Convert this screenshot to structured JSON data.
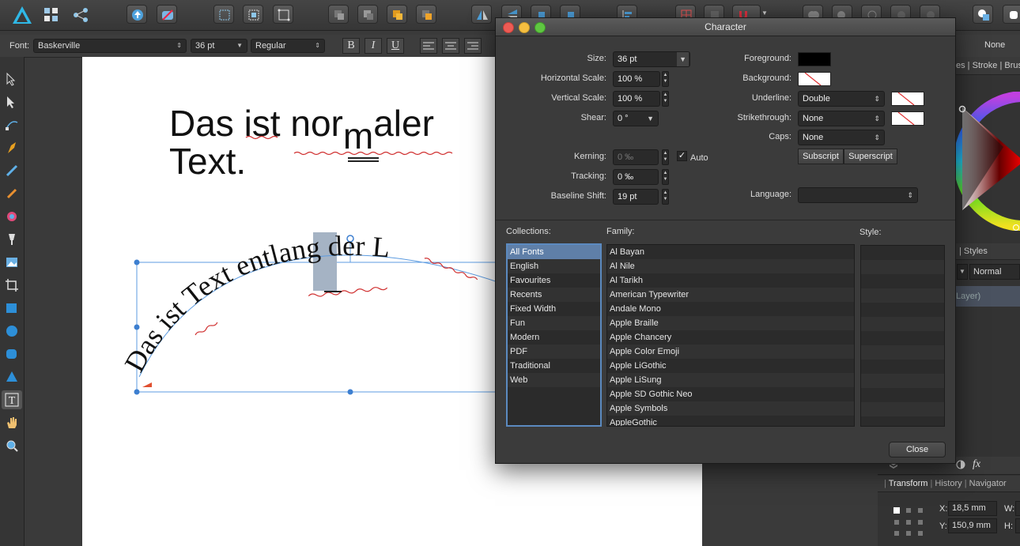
{
  "context_bar": {
    "font_label": "Font:",
    "font_name": "Baskerville",
    "font_size": "36 pt",
    "font_style": "Regular",
    "bold": "B",
    "italic": "I",
    "underline": "U",
    "right_value": "None"
  },
  "canvas": {
    "line1": "Das ist nor",
    "line1_raised": "m",
    "line1_end": "aler",
    "line2": "Text.",
    "curved_text": "Das ist Text entlang der L"
  },
  "right_panel": {
    "tabs_top": [
      "es",
      "Stroke",
      "Brush"
    ],
    "styles_tab": "Styles",
    "blend_mode": "Normal",
    "layer": "Layer)",
    "fx": "fx",
    "tabs_bottom": [
      "Transform",
      "History",
      "Navigator"
    ],
    "x_label": "X:",
    "x_value": "18,5 mm",
    "y_label": "Y:",
    "y_value": "150,9 mm",
    "w_label": "W:",
    "h_label": "H:"
  },
  "dialog": {
    "title": "Character",
    "size_label": "Size:",
    "size_value": "36 pt",
    "hscale_label": "Horizontal Scale:",
    "hscale_value": "100 %",
    "vscale_label": "Vertical Scale:",
    "vscale_value": "100 %",
    "shear_label": "Shear:",
    "shear_value": "0 °",
    "kerning_label": "Kerning:",
    "kerning_value": "0 ‰",
    "auto_label": "Auto",
    "tracking_label": "Tracking:",
    "tracking_value": "0 ‰",
    "baseline_label": "Baseline Shift:",
    "baseline_value": "19 pt",
    "foreground_label": "Foreground:",
    "foreground_color": "#000000",
    "background_label": "Background:",
    "underline_label": "Underline:",
    "underline_value": "Double",
    "strike_label": "Strikethrough:",
    "strike_value": "None",
    "caps_label": "Caps:",
    "caps_value": "None",
    "subscript": "Subscript",
    "superscript": "Superscript",
    "language_label": "Language:",
    "language_value": "",
    "collections_label": "Collections:",
    "family_label": "Family:",
    "style_label": "Style:",
    "collections": [
      "All Fonts",
      "English",
      "Favourites",
      "Recents",
      "Fixed Width",
      "Fun",
      "Modern",
      "PDF",
      "Traditional",
      "Web"
    ],
    "families": [
      "Al Bayan",
      "Al Nile",
      "Al Tarikh",
      "American Typewriter",
      "Andale Mono",
      "Apple Braille",
      "Apple Chancery",
      "Apple Color Emoji",
      "Apple LiGothic",
      "Apple LiSung",
      "Apple SD Gothic Neo",
      "Apple Symbols",
      "AppleGothic"
    ],
    "close": "Close"
  }
}
